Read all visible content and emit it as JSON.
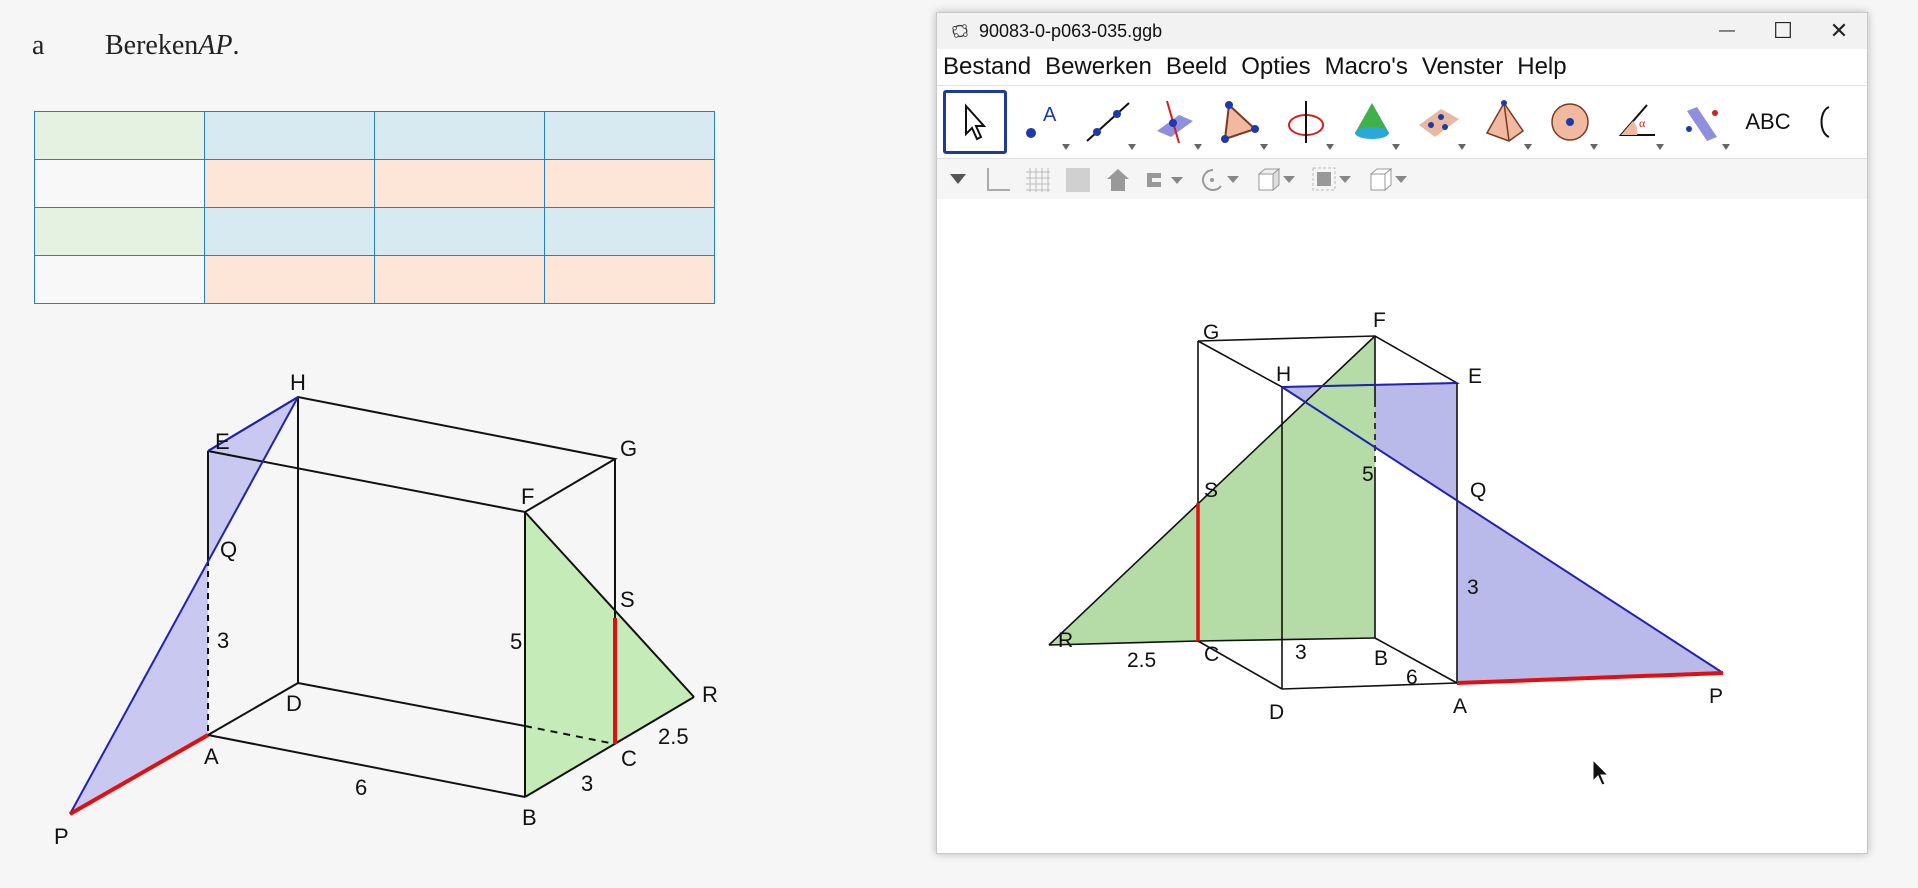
{
  "question": {
    "label": "a",
    "text": "Bereken",
    "var": "AP",
    "end": "."
  },
  "table_rows": [
    [
      "g",
      "b",
      "b",
      "b"
    ],
    [
      "w",
      "o",
      "o",
      "o"
    ],
    [
      "g",
      "b",
      "b",
      "b"
    ],
    [
      "w",
      "o",
      "o",
      "o"
    ]
  ],
  "left_figure": {
    "points": {
      "H": "H",
      "E": "E",
      "G": "G",
      "F": "F",
      "Q": "Q",
      "S": "S",
      "R": "R",
      "D": "D",
      "A": "A",
      "C": "C",
      "B": "B",
      "P": "P"
    },
    "measures": {
      "m3": "3",
      "m5": "5",
      "m6": "6",
      "m3b": "3",
      "m25": "2.5"
    }
  },
  "window": {
    "title": "90083-0-p063-035.ggb",
    "controls": {
      "minimize": "—",
      "maximize": "☐",
      "close": "✕"
    },
    "menu": [
      "Bestand",
      "Bewerken",
      "Beeld",
      "Opties",
      "Macro's",
      "Venster",
      "Help"
    ],
    "toolbar_text_tool": "ABC",
    "colors": {
      "blue_face": "#b9b9ea",
      "green_face": "#b5dba6",
      "red_edge": "#e01010",
      "blue_edge": "#2222b0"
    }
  },
  "geogebra_figure": {
    "points": {
      "G": "G",
      "F": "F",
      "H": "H",
      "E": "E",
      "S": "S",
      "Q": "Q",
      "R": "R",
      "C": "C",
      "B": "B",
      "D": "D",
      "A": "A",
      "P": "P"
    },
    "measures": {
      "m5": "5",
      "m3": "3",
      "m25": "2.5",
      "m3b": "3",
      "m6": "6"
    }
  }
}
